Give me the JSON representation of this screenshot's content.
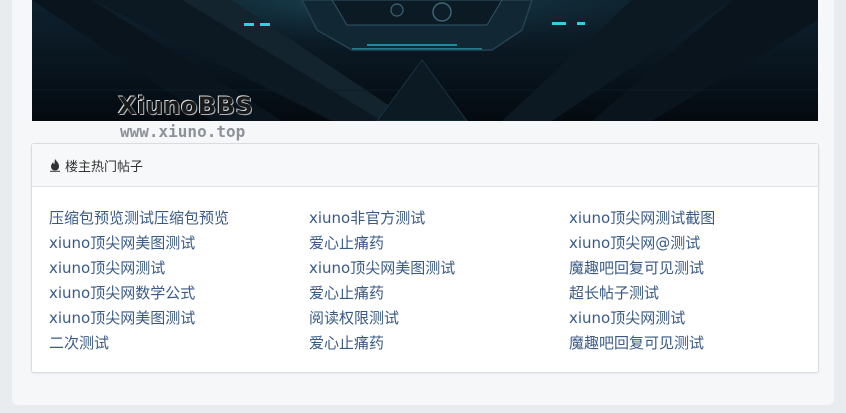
{
  "watermark": {
    "title": "XiunoBBS",
    "url": "www.xiuno.top"
  },
  "colors": {
    "link": "#3a5a86",
    "banner_bg": "#07111a",
    "banner_accent": "#2fd0e0"
  },
  "hot_threads": {
    "header_icon": "fire-icon",
    "header": "楼主热门帖子",
    "columns": [
      [
        "压缩包预览测试压缩包预览",
        "xiuno顶尖网美图测试",
        "xiuno顶尖网测试",
        "xiuno顶尖网数学公式",
        "xiuno顶尖网美图测试",
        "二次测试"
      ],
      [
        "xiuno非官方测试",
        "爱心止痛药",
        "xiuno顶尖网美图测试",
        "爱心止痛药",
        "阅读权限测试",
        "爱心止痛药"
      ],
      [
        "xiuno顶尖网测试截图",
        "xiuno顶尖网@测试",
        "魔趣吧回复可见测试",
        "超长帖子测试",
        "xiuno顶尖网测试",
        "魔趣吧回复可见测试"
      ]
    ]
  }
}
